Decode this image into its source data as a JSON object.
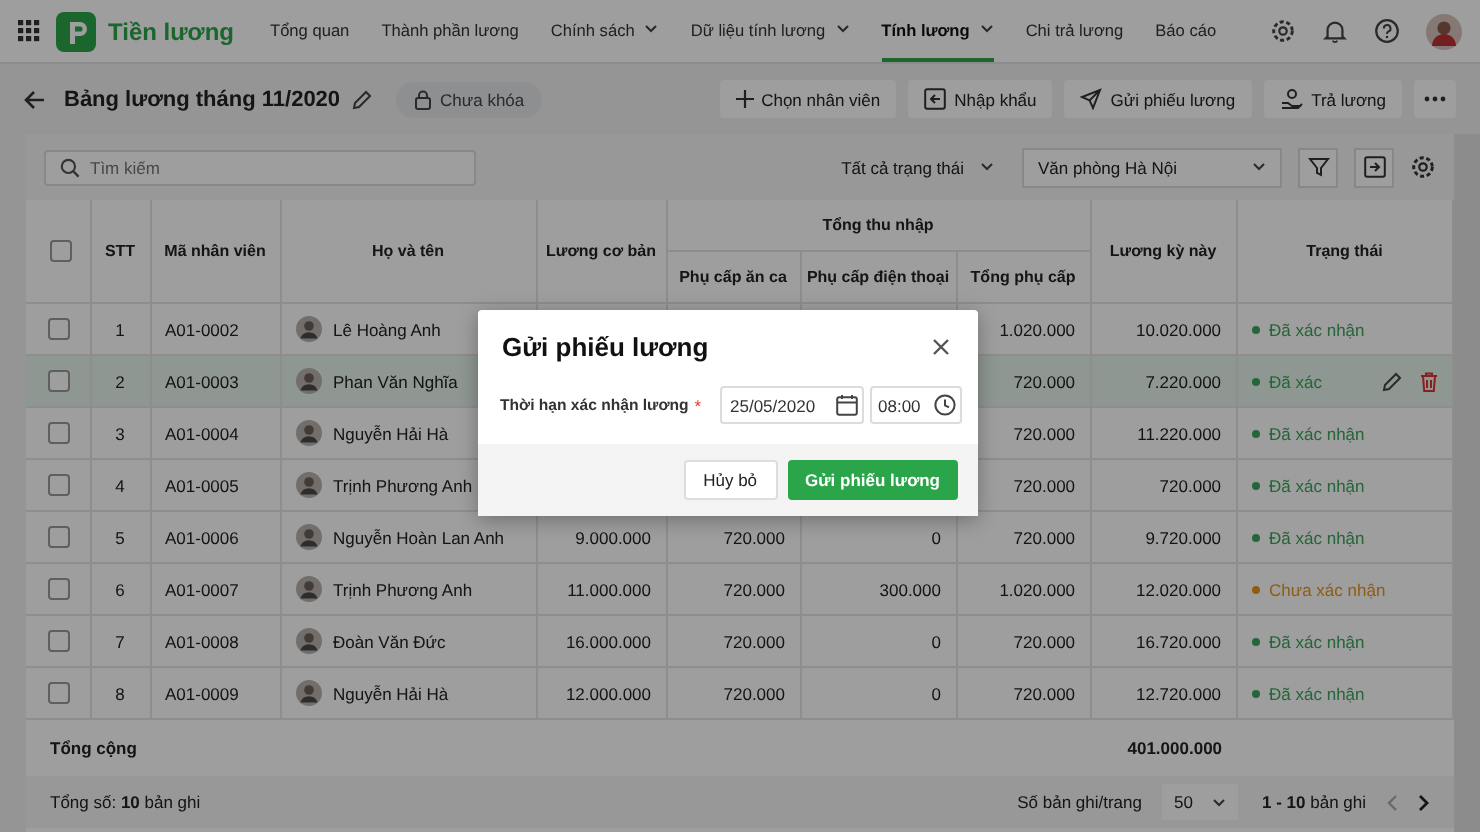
{
  "app": {
    "name": "Tiền lương"
  },
  "nav": [
    {
      "label": "Tổng quan",
      "dropdown": false,
      "selected": false
    },
    {
      "label": "Thành phần lương",
      "dropdown": false,
      "selected": false
    },
    {
      "label": "Chính sách",
      "dropdown": true,
      "selected": false
    },
    {
      "label": "Dữ liệu tính lương",
      "dropdown": true,
      "selected": false
    },
    {
      "label": "Tính lương",
      "dropdown": true,
      "selected": true
    },
    {
      "label": "Chi trả lương",
      "dropdown": false,
      "selected": false
    },
    {
      "label": "Báo cáo",
      "dropdown": false,
      "selected": false
    }
  ],
  "page": {
    "title": "Bảng lương tháng 11/2020",
    "lock_status": "Chưa khóa"
  },
  "actions": [
    {
      "label": "Chọn nhân viên",
      "kind": "add"
    },
    {
      "label": "Nhập khẩu",
      "kind": "import"
    },
    {
      "label": "Gửi phiếu lương",
      "kind": "send"
    },
    {
      "label": "Trả lương",
      "kind": "pay"
    }
  ],
  "filters": {
    "search_placeholder": "Tìm kiếm",
    "status": "Tất cả trạng thái",
    "office": "Văn phòng Hà Nội"
  },
  "table": {
    "select_all_checked": false,
    "columns": [
      {
        "label": "STT"
      },
      {
        "label": "Mã nhân viên"
      },
      {
        "label": "Họ và tên"
      },
      {
        "label": "Lương cơ bản"
      },
      {
        "label": "Tổng thu nhập",
        "children": [
          {
            "label": "Phụ cấp ăn ca"
          },
          {
            "label": "Phụ cấp điện thoại"
          },
          {
            "label": "Tổng phụ cấp"
          }
        ]
      },
      {
        "label": "Lương kỳ này"
      },
      {
        "label": "Trạng thái"
      }
    ],
    "rows": [
      {
        "stt": "1",
        "code": "A01-0002",
        "name": "Lê Hoàng Anh",
        "allowance": "1.020.000",
        "net": "10.020.000",
        "status": "Đã xác nhận",
        "color": "#246638",
        "checked": false,
        "highlighted": false
      },
      {
        "stt": "2",
        "code": "A01-0003",
        "name": "Phan Văn Nghĩa",
        "allowance": "720.000",
        "net": "7.220.000",
        "status": "Đã xác",
        "color": "#246638",
        "checked": false,
        "highlighted": true
      },
      {
        "stt": "3",
        "code": "A01-0004",
        "name": "Nguyễn Hải Hà",
        "allowance": "720.000",
        "net": "11.220.000",
        "status": "Đã xác nhận",
        "color": "#246638",
        "checked": false,
        "highlighted": false
      },
      {
        "stt": "4",
        "code": "A01-0005",
        "name": "Trịnh Phương Anh",
        "allowance": "720.000",
        "net": "720.000",
        "status": "Đã xác nhận",
        "color": "#246638",
        "checked": false,
        "highlighted": false
      },
      {
        "stt": "5",
        "code": "A01-0006",
        "name": "Nguyễn Hoàn Lan Anh",
        "basic": "9.000.000",
        "meal": "720.000",
        "phone": "0",
        "allowance": "720.000",
        "net": "9.720.000",
        "status": "Đã xác nhận",
        "color": "#246638",
        "checked": false,
        "highlighted": false
      },
      {
        "stt": "6",
        "code": "A01-0007",
        "name": "Trịnh Phương Anh",
        "basic": "11.000.000",
        "meal": "720.000",
        "phone": "300.000",
        "allowance": "1.020.000",
        "net": "12.020.000",
        "status": "Chưa xác nhận",
        "color": "#905c10",
        "checked": false,
        "highlighted": false
      },
      {
        "stt": "7",
        "code": "A01-0008",
        "name": "Đoàn Văn Đức",
        "basic": "16.000.000",
        "meal": "720.000",
        "phone": "0",
        "allowance": "720.000",
        "net": "16.720.000",
        "status": "Đã xác nhận",
        "color": "#246638",
        "checked": false,
        "highlighted": false
      },
      {
        "stt": "8",
        "code": "A01-0009",
        "name": "Nguyễn Hải Hà",
        "basic": "12.000.000",
        "meal": "720.000",
        "phone": "0",
        "allowance": "720.000",
        "net": "12.720.000",
        "status": "Đã xác nhận",
        "color": "#246638",
        "checked": false,
        "highlighted": false
      }
    ],
    "total_label": "Tổng cộng",
    "total": "401.000.000"
  },
  "footer": {
    "count": "Tổng số: **10** bản ghi",
    "per_page_label": "Số bản ghi/trang",
    "per_page": "50",
    "range": "**1 - 10** bản ghi"
  },
  "dialog": {
    "title": "Gửi phiếu lương",
    "field_label": "Thời hạn xác nhận lương",
    "required_mark": "*",
    "date": "25/05/2020",
    "time": "08:00",
    "buttons": [
      "Hủy bỏ",
      "Gửi phiếu lương"
    ]
  }
}
